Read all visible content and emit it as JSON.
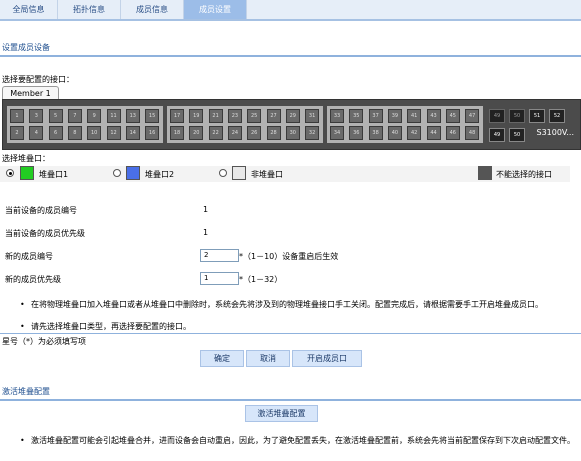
{
  "tabs": [
    "全局信息",
    "拓扑信息",
    "成员信息",
    "成员设置"
  ],
  "section1": {
    "title": "设置成员设备"
  },
  "select_port": {
    "label": "选择要配置的接口：",
    "member_tab": "Member 1"
  },
  "panel": {
    "top_ports": [
      "1",
      "3",
      "5",
      "7",
      "9",
      "11",
      "13",
      "15",
      "17",
      "19",
      "21",
      "23",
      "25",
      "27",
      "29",
      "31",
      "33",
      "35",
      "37",
      "39",
      "41",
      "43",
      "45",
      "47"
    ],
    "bottom_ports": [
      "2",
      "4",
      "6",
      "8",
      "10",
      "12",
      "14",
      "16",
      "18",
      "20",
      "22",
      "24",
      "26",
      "28",
      "30",
      "32",
      "34",
      "36",
      "38",
      "40",
      "42",
      "44",
      "46",
      "48"
    ],
    "sfp_top": [
      "49",
      "50",
      "51",
      "52"
    ],
    "sfp_bottom": [
      "49",
      "50"
    ],
    "model": "S3100V..."
  },
  "stack_select": {
    "label": "选择堆叠口：",
    "options": [
      {
        "label": "堆叠口1",
        "selected": true,
        "color": "#22cc22"
      },
      {
        "label": "堆叠口2",
        "selected": false,
        "color": "#4a6fe8"
      },
      {
        "label": "非堆叠口",
        "selected": false,
        "color": "#e8e8e8"
      }
    ],
    "unselectable": {
      "label": "不能选择的接口",
      "color": "#555555"
    }
  },
  "fields": {
    "current_member_no_label": "当前设备的成员编号",
    "current_member_no": "1",
    "current_priority_label": "当前设备的成员优先级",
    "current_priority": "1",
    "new_member_no_label": "新的成员编号",
    "new_member_no": "2",
    "new_member_no_hint": "*（1－10）设备重启后生效",
    "new_priority_label": "新的成员优先级",
    "new_priority": "1",
    "new_priority_hint": "*（1－32）"
  },
  "notes": [
    "在将物理堆叠口加入堆叠口或者从堆叠口中删除时，系统会先将涉及到的物理堆叠接口手工关闭。配置完成后，请根据需要手工开启堆叠成员口。",
    "请先选择堆叠口类型，再选择要配置的接口。"
  ],
  "required_note": "星号（*）为必须填写项",
  "buttons": {
    "ok": "确定",
    "cancel": "取消",
    "open_member_port": "开启成员口"
  },
  "section2": {
    "title": "激活堆叠配置",
    "button": "激活堆叠配置",
    "note": "激活堆叠配置可能会引起堆叠合并，进而设备会自动重启，因此，为了避免配置丢失，在激活堆叠配置前，系统会先将当前配置保存到下次启动配置文件。"
  }
}
